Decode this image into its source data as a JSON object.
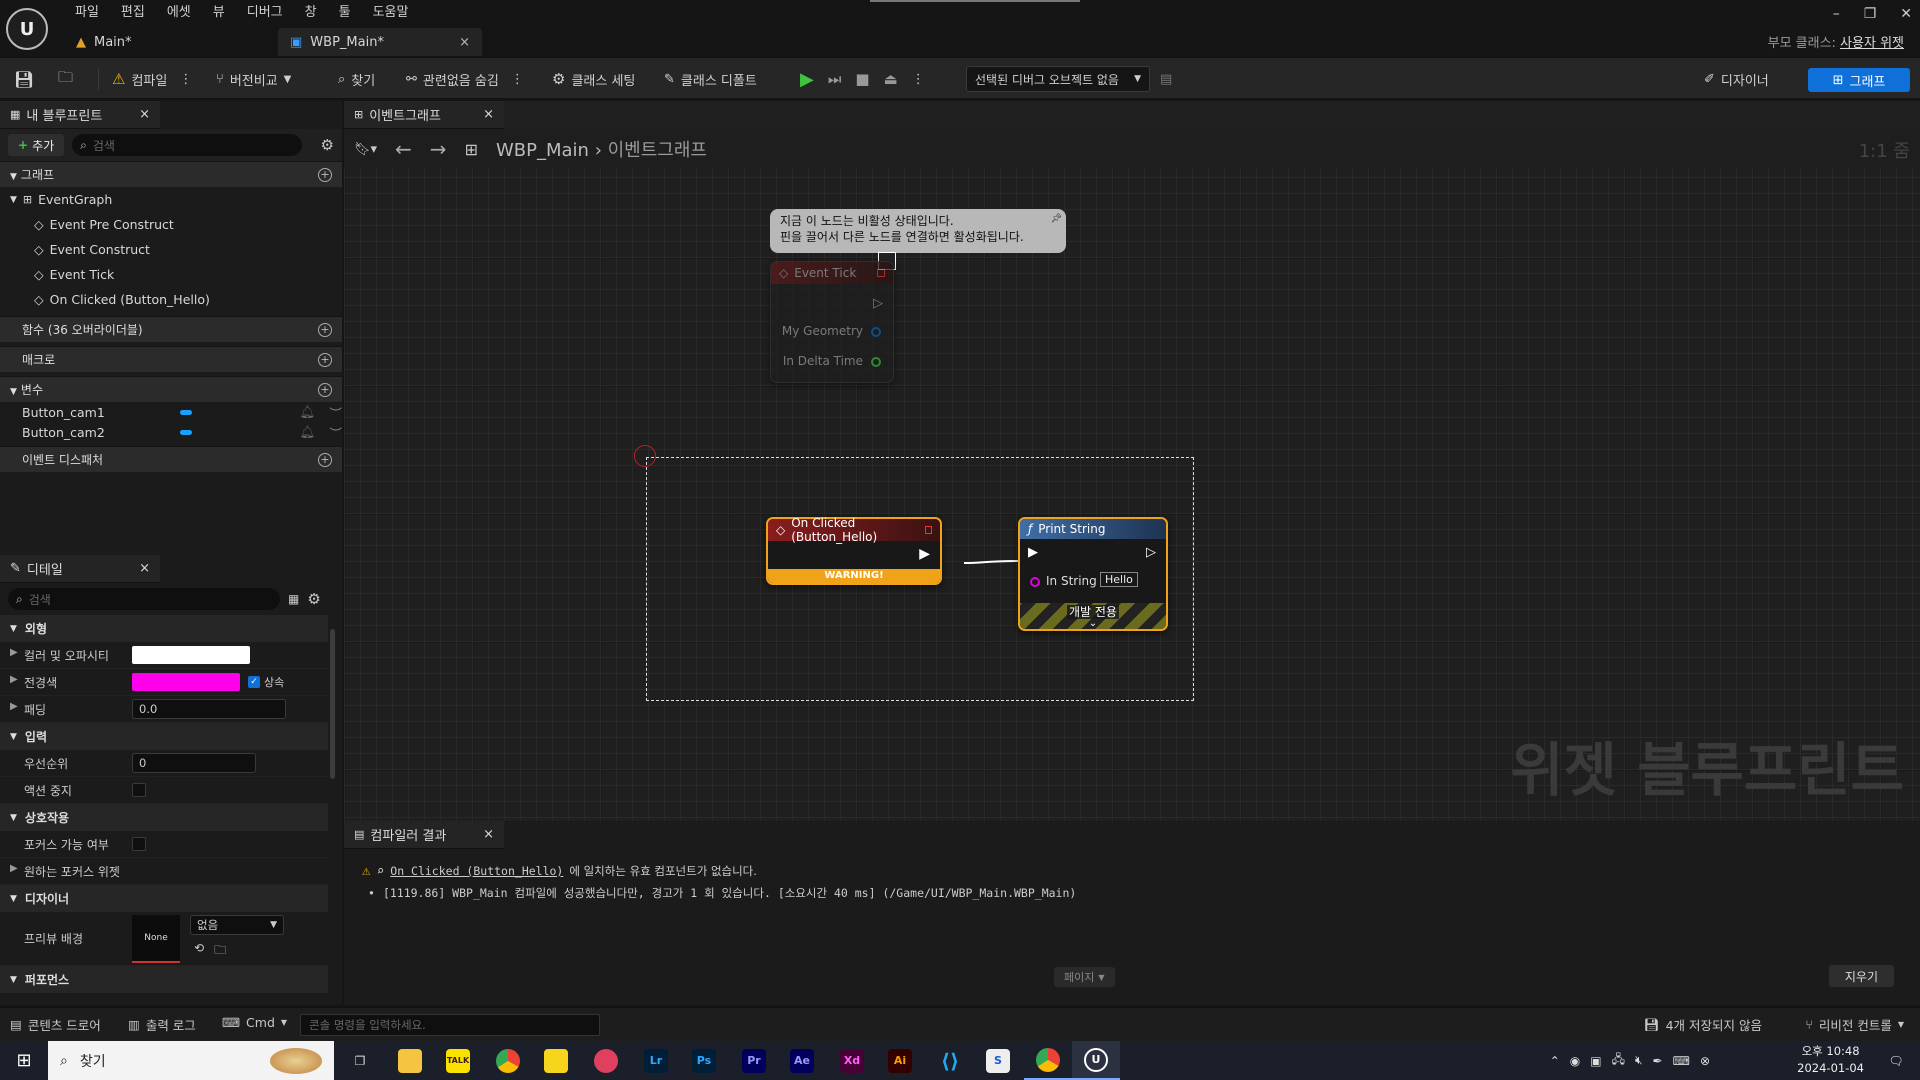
{
  "app": {
    "menu": [
      "파일",
      "편집",
      "에셋",
      "뷰",
      "디버그",
      "창",
      "툴",
      "도움말"
    ],
    "tabs": [
      {
        "label": "Main*"
      },
      {
        "label": "WBP_Main*"
      }
    ],
    "parent_class_label": "부모 클래스:",
    "parent_class_value": "사용자 위젯"
  },
  "toolbar": {
    "compile": "컴파일",
    "diff": "버전비교",
    "find": "찾기",
    "hide_unrelated": "관련없음 숨김",
    "class_settings": "클래스 세팅",
    "class_defaults": "클래스 디폴트",
    "debug_object": "선택된 디버그 오브젝트 없음",
    "designer": "디자이너",
    "graph": "그래프"
  },
  "my_blueprint": {
    "tab_title": "내 블루프린트",
    "add_button": "추가",
    "search_placeholder": "검색",
    "sections": {
      "graphs": "그래프",
      "functions": "함수 (36 오버라이더블)",
      "macros": "매크로",
      "variables": "변수",
      "event_dispatchers": "이벤트 디스패처"
    },
    "event_graph": "EventGraph",
    "events": [
      "Event Pre Construct",
      "Event Construct",
      "Event Tick",
      "On Clicked (Button_Hello)"
    ],
    "variables": [
      "Button_cam1",
      "Button_cam2"
    ]
  },
  "details": {
    "tab_title": "디테일",
    "search_placeholder": "검색",
    "sections": {
      "appearance": "외형",
      "input": "입력",
      "interaction": "상호작용",
      "designer": "디자이너",
      "performance": "퍼포먼스"
    },
    "rows": {
      "color_opacity": "컬러 및 오파시티",
      "foreground": "전경색",
      "inherit": "상속",
      "padding": "패딩",
      "padding_value": "0.0",
      "priority": "우선순위",
      "priority_value": "0",
      "stop_action": "액션 중지",
      "focusable": "포커스 가능 여부",
      "desired_focus": "원하는 포커스 위젯",
      "preview_bg": "프리뷰 배경",
      "preview_none": "None",
      "preview_dropdown": "없음"
    }
  },
  "graph": {
    "tab_title": "이벤트그래프",
    "breadcrumb_root": "WBP_Main",
    "breadcrumb_current": "이벤트그래프",
    "zoom": "1:1 줌",
    "watermark": "위젯 블루프린트",
    "disabled_tooltip_line1": "지금 이 노드는 비활성 상태입니다.",
    "disabled_tooltip_line2": "핀을 끌어서 다른 노드를 연결하면 활성화됩니다.",
    "event_tick": {
      "title": "Event Tick",
      "pin1": "My Geometry",
      "pin2": "In Delta Time"
    },
    "on_clicked": {
      "title": "On Clicked (Button_Hello)",
      "warning": "WARNING!"
    },
    "print_string": {
      "title": "Print String",
      "pin": "In String",
      "value": "Hello",
      "dev_only": "개발 전용"
    }
  },
  "compiler": {
    "tab_title": "컴파일러 결과",
    "warning_link": "On Clicked (Button_Hello)",
    "warning_text": "에 일치하는 유효 컴포넌트가 없습니다.",
    "log_line": "[1119.86] WBP_Main 컴파일에 성공했습니다만, 경고가 1 회 있습니다. [소요시간 40 ms] (/Game/UI/WBP_Main.WBP_Main)",
    "page_button": "페이지",
    "clear_button": "지우기"
  },
  "statusbar": {
    "content_drawer": "콘텐츠 드로어",
    "output_log": "출력 로그",
    "cmd": "Cmd",
    "console_placeholder": "콘솔 명령을 입력하세요.",
    "unsaved": "4개 저장되지 않음",
    "revision": "리비전 컨트롤"
  },
  "taskbar": {
    "search": "찾기",
    "time": "오후 10:48",
    "date": "2024-01-04",
    "apps": [
      "Lr",
      "Ps",
      "Pr",
      "Ae",
      "Xd",
      "Ai"
    ]
  },
  "colors": {
    "accent_blue": "#0e70d8",
    "node_selected": "#f0a319",
    "event_red": "#8a1d1d",
    "pin_magenta": "#e000d8"
  }
}
